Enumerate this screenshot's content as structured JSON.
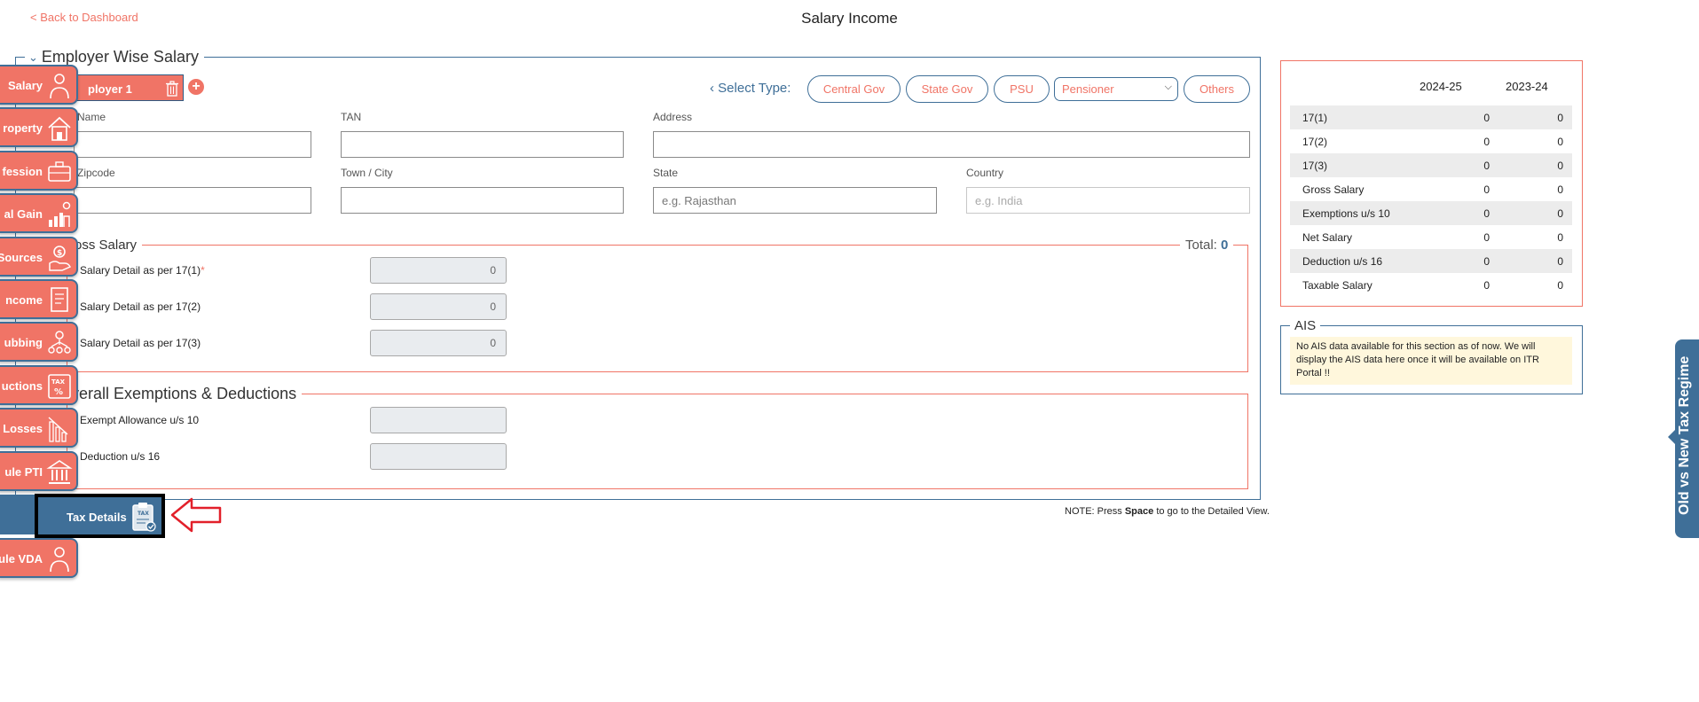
{
  "header": {
    "back_label": "< Back to Dashboard",
    "title": "Salary Income"
  },
  "employer": {
    "legend": "Employer Wise Salary",
    "tab_label": "ployer 1",
    "select_type_label": "Select Type:",
    "types": [
      "Central Gov",
      "State Gov",
      "PSU",
      "Others"
    ],
    "selected_type": "Pensioner",
    "fields": {
      "name_label": "Name",
      "tan_label": "TAN",
      "address_label": "Address",
      "zipcode_label": "Zipcode",
      "city_label": "Town / City",
      "state_label": "State",
      "country_label": "Country",
      "state_placeholder": "e.g. Rajasthan",
      "country_placeholder": "e.g. India"
    }
  },
  "gross": {
    "legend": "oss Salary",
    "total_label": "Total:",
    "total_value": "0",
    "rows": [
      {
        "label": "Salary Detail as per 17(1)",
        "required": "*",
        "value": "0"
      },
      {
        "label": "Salary Detail as per 17(2)",
        "value": "0"
      },
      {
        "label": "Salary Detail as per 17(3)",
        "value": "0"
      }
    ]
  },
  "deductions": {
    "legend": "verall Exemptions & Deductions",
    "rows": [
      {
        "label": "Exempt Allowance u/s 10"
      },
      {
        "label": "Deduction u/s 16"
      }
    ]
  },
  "note": {
    "prefix": "NOTE: Press ",
    "key": "Space",
    "suffix": " to go to the Detailed View."
  },
  "summary": {
    "years": [
      "2024-25",
      "2023-24"
    ],
    "rows": [
      [
        "17(1)",
        "0",
        "0"
      ],
      [
        "17(2)",
        "0",
        "0"
      ],
      [
        "17(3)",
        "0",
        "0"
      ],
      [
        "Gross Salary",
        "0",
        "0"
      ],
      [
        "Exemptions u/s 10",
        "0",
        "0"
      ],
      [
        "Net Salary",
        "0",
        "0"
      ],
      [
        "Deduction u/s 16",
        "0",
        "0"
      ],
      [
        "Taxable Salary",
        "0",
        "0"
      ]
    ]
  },
  "ais": {
    "legend": "AIS",
    "message": "No AIS data available for this section as of now. We will display the AIS data here once it will be available on ITR Portal !!"
  },
  "sidebar": {
    "items": [
      {
        "label": "Salary",
        "icon": "person-icon"
      },
      {
        "label": "roperty",
        "icon": "house-icon"
      },
      {
        "label": "fession",
        "icon": "briefcase-icon"
      },
      {
        "label": "al Gain",
        "icon": "chart-person-icon"
      },
      {
        "label": "Sources",
        "icon": "money-hand-icon"
      },
      {
        "label": "ncome",
        "icon": "document-icon"
      },
      {
        "label": "ubbing",
        "icon": "group-icon"
      },
      {
        "label": "uctions",
        "icon": "tax-percent-icon"
      },
      {
        "label": "Losses",
        "icon": "chart-down-icon"
      },
      {
        "label": "ule PTI",
        "icon": "bank-icon"
      }
    ],
    "active_label": "Tax Details",
    "last_item_label": "ule VDA"
  },
  "regime_tab": "Old vs New Tax Regime",
  "colors": {
    "accent": "#f07466",
    "primary": "#3f6f98"
  }
}
